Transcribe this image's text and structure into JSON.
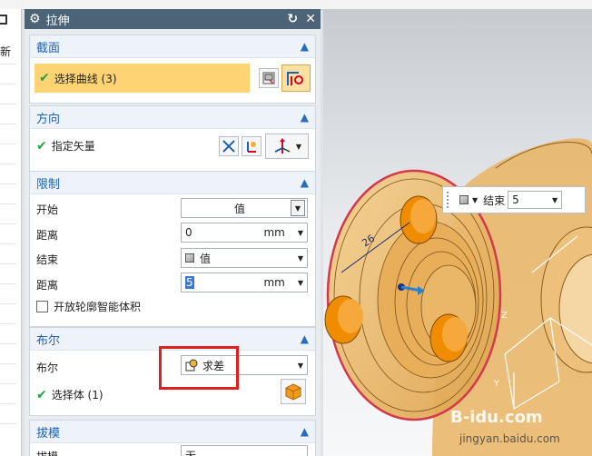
{
  "dialog": {
    "title": "拉伸"
  },
  "left_panel": {
    "header_label": "新"
  },
  "sections": {
    "section": {
      "title": "截面",
      "select_curve": "选择曲线 (3)"
    },
    "direction": {
      "title": "方向",
      "vector": "指定矢量"
    },
    "limits": {
      "title": "限制",
      "start_label": "开始",
      "start_value": "值",
      "start_dist_label": "距离",
      "start_dist_value": "0",
      "start_unit": "mm",
      "end_label": "结束",
      "end_value": "值",
      "end_dist_label": "距离",
      "end_dist_value": "5",
      "end_unit": "mm",
      "open_profile": "开放轮廓智能体积"
    },
    "boolean": {
      "title": "布尔",
      "bool_label": "布尔",
      "bool_value": "求差",
      "select_body": "选择体 (1)"
    },
    "draft": {
      "title": "拔模",
      "draft_label": "拔模",
      "draft_value": "无"
    }
  },
  "float_toolbar": {
    "end_label": "结束",
    "end_value": "5"
  },
  "viewport": {
    "dimension": "26",
    "axis_z": "Z",
    "axis_y": "Y"
  },
  "watermark": {
    "line1": "B-idu.com",
    "line2": "jingyan.baidu.com"
  },
  "colors": {
    "accent": "#1f63b8",
    "highlight": "#fdd373",
    "titlebar": "#4d6477",
    "redbox": "#e02020"
  }
}
